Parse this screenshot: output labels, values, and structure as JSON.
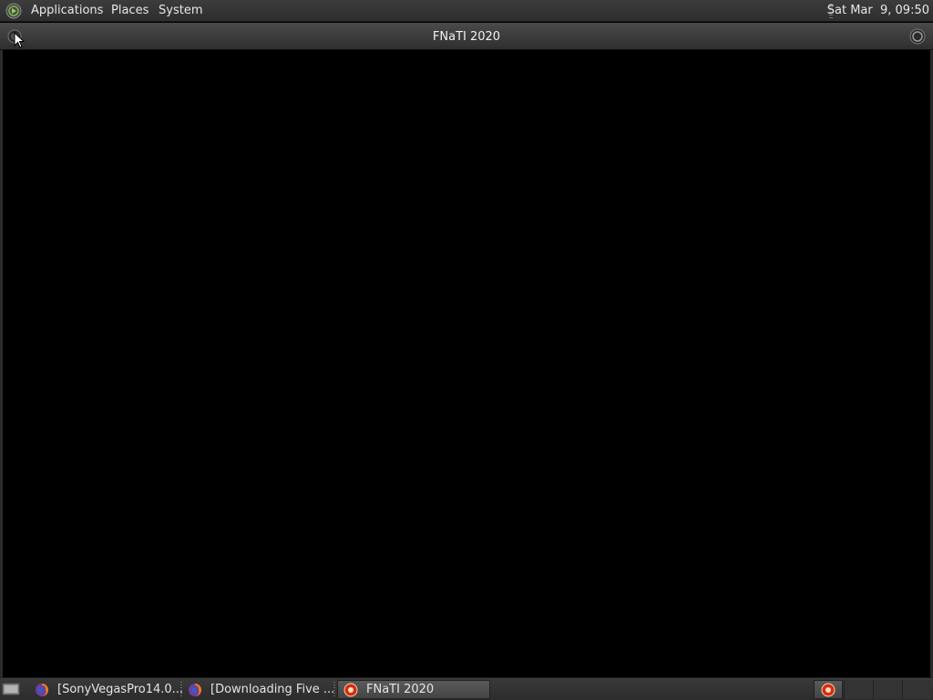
{
  "top_panel": {
    "menus": {
      "applications": "Applications",
      "places": "Places",
      "system": "System"
    },
    "clock": "Sat Mar  9, 09:50",
    "logo_icon": "mate-menu-icon"
  },
  "window": {
    "title": "FNaTI 2020",
    "menu_icon": "window-menu-icon",
    "close_icon": "window-close-icon"
  },
  "taskbar": {
    "tasks": [
      {
        "label": "[SonyVegasPro14.0...",
        "icon": "firefox-icon",
        "active": false
      },
      {
        "label": "[Downloading Five ...",
        "icon": "firefox-icon",
        "active": false
      },
      {
        "label": "FNaTI 2020",
        "icon": "fnati-game-icon",
        "active": true
      }
    ],
    "show_desktop_icon": "show-desktop-icon",
    "workspaces": 3
  },
  "colors": {
    "panel": "#333333",
    "window_bg": "#000000",
    "text": "#e6e6e6",
    "game_icon_red": "#d62a1a"
  }
}
